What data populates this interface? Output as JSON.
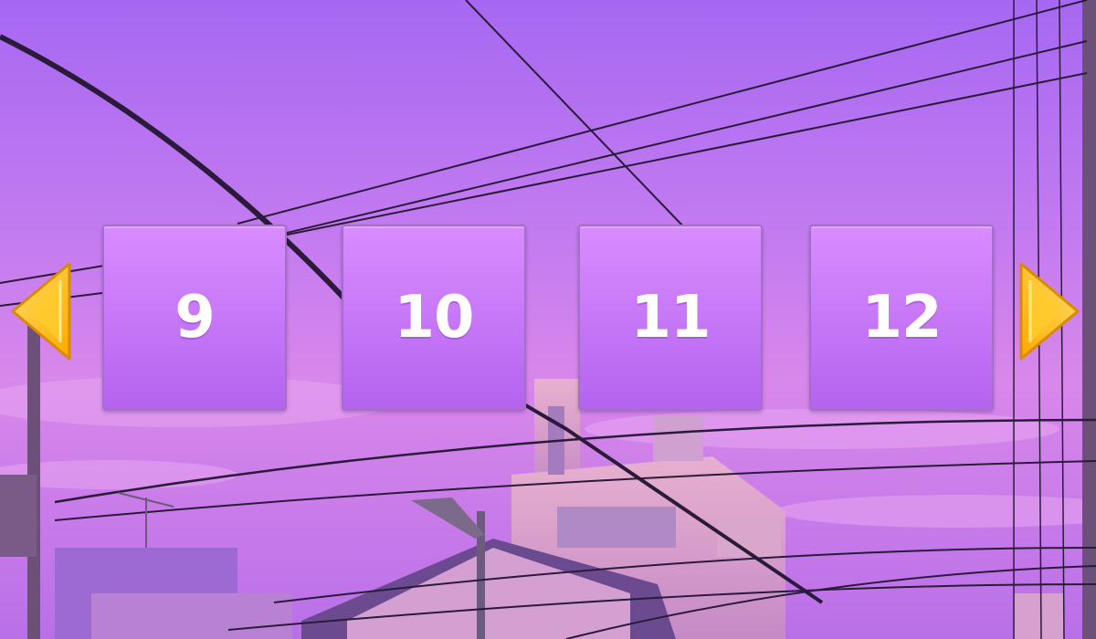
{
  "levels": [
    {
      "label": "9"
    },
    {
      "label": "10"
    },
    {
      "label": "11"
    },
    {
      "label": "12"
    }
  ],
  "nav": {
    "prev_icon": "arrow-left-icon",
    "next_icon": "arrow-right-icon"
  },
  "colors": {
    "tile_fill": "#c97af7",
    "tile_border": "#a36fc9",
    "arrow_fill": "#ffc21a",
    "sky_top": "#a86bf2",
    "sky_bottom": "#e08ae8"
  }
}
